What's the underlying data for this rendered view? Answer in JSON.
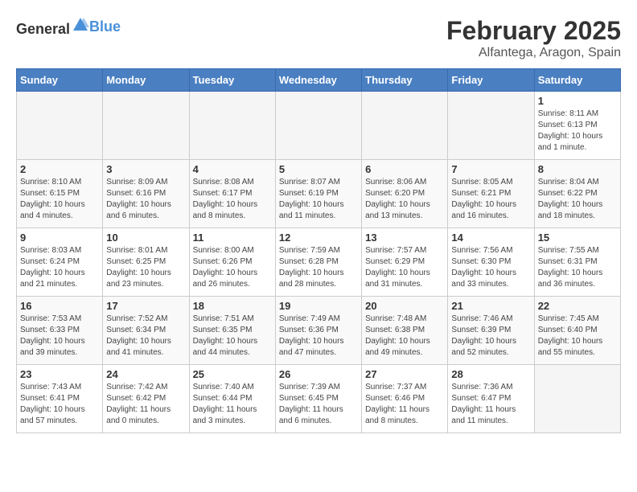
{
  "logo": {
    "general": "General",
    "blue": "Blue"
  },
  "title": "February 2025",
  "subtitle": "Alfantega, Aragon, Spain",
  "days_of_week": [
    "Sunday",
    "Monday",
    "Tuesday",
    "Wednesday",
    "Thursday",
    "Friday",
    "Saturday"
  ],
  "weeks": [
    [
      {
        "day": "",
        "info": ""
      },
      {
        "day": "",
        "info": ""
      },
      {
        "day": "",
        "info": ""
      },
      {
        "day": "",
        "info": ""
      },
      {
        "day": "",
        "info": ""
      },
      {
        "day": "",
        "info": ""
      },
      {
        "day": "1",
        "info": "Sunrise: 8:11 AM\nSunset: 6:13 PM\nDaylight: 10 hours and 1 minute."
      }
    ],
    [
      {
        "day": "2",
        "info": "Sunrise: 8:10 AM\nSunset: 6:15 PM\nDaylight: 10 hours and 4 minutes."
      },
      {
        "day": "3",
        "info": "Sunrise: 8:09 AM\nSunset: 6:16 PM\nDaylight: 10 hours and 6 minutes."
      },
      {
        "day": "4",
        "info": "Sunrise: 8:08 AM\nSunset: 6:17 PM\nDaylight: 10 hours and 8 minutes."
      },
      {
        "day": "5",
        "info": "Sunrise: 8:07 AM\nSunset: 6:19 PM\nDaylight: 10 hours and 11 minutes."
      },
      {
        "day": "6",
        "info": "Sunrise: 8:06 AM\nSunset: 6:20 PM\nDaylight: 10 hours and 13 minutes."
      },
      {
        "day": "7",
        "info": "Sunrise: 8:05 AM\nSunset: 6:21 PM\nDaylight: 10 hours and 16 minutes."
      },
      {
        "day": "8",
        "info": "Sunrise: 8:04 AM\nSunset: 6:22 PM\nDaylight: 10 hours and 18 minutes."
      }
    ],
    [
      {
        "day": "9",
        "info": "Sunrise: 8:03 AM\nSunset: 6:24 PM\nDaylight: 10 hours and 21 minutes."
      },
      {
        "day": "10",
        "info": "Sunrise: 8:01 AM\nSunset: 6:25 PM\nDaylight: 10 hours and 23 minutes."
      },
      {
        "day": "11",
        "info": "Sunrise: 8:00 AM\nSunset: 6:26 PM\nDaylight: 10 hours and 26 minutes."
      },
      {
        "day": "12",
        "info": "Sunrise: 7:59 AM\nSunset: 6:28 PM\nDaylight: 10 hours and 28 minutes."
      },
      {
        "day": "13",
        "info": "Sunrise: 7:57 AM\nSunset: 6:29 PM\nDaylight: 10 hours and 31 minutes."
      },
      {
        "day": "14",
        "info": "Sunrise: 7:56 AM\nSunset: 6:30 PM\nDaylight: 10 hours and 33 minutes."
      },
      {
        "day": "15",
        "info": "Sunrise: 7:55 AM\nSunset: 6:31 PM\nDaylight: 10 hours and 36 minutes."
      }
    ],
    [
      {
        "day": "16",
        "info": "Sunrise: 7:53 AM\nSunset: 6:33 PM\nDaylight: 10 hours and 39 minutes."
      },
      {
        "day": "17",
        "info": "Sunrise: 7:52 AM\nSunset: 6:34 PM\nDaylight: 10 hours and 41 minutes."
      },
      {
        "day": "18",
        "info": "Sunrise: 7:51 AM\nSunset: 6:35 PM\nDaylight: 10 hours and 44 minutes."
      },
      {
        "day": "19",
        "info": "Sunrise: 7:49 AM\nSunset: 6:36 PM\nDaylight: 10 hours and 47 minutes."
      },
      {
        "day": "20",
        "info": "Sunrise: 7:48 AM\nSunset: 6:38 PM\nDaylight: 10 hours and 49 minutes."
      },
      {
        "day": "21",
        "info": "Sunrise: 7:46 AM\nSunset: 6:39 PM\nDaylight: 10 hours and 52 minutes."
      },
      {
        "day": "22",
        "info": "Sunrise: 7:45 AM\nSunset: 6:40 PM\nDaylight: 10 hours and 55 minutes."
      }
    ],
    [
      {
        "day": "23",
        "info": "Sunrise: 7:43 AM\nSunset: 6:41 PM\nDaylight: 10 hours and 57 minutes."
      },
      {
        "day": "24",
        "info": "Sunrise: 7:42 AM\nSunset: 6:42 PM\nDaylight: 11 hours and 0 minutes."
      },
      {
        "day": "25",
        "info": "Sunrise: 7:40 AM\nSunset: 6:44 PM\nDaylight: 11 hours and 3 minutes."
      },
      {
        "day": "26",
        "info": "Sunrise: 7:39 AM\nSunset: 6:45 PM\nDaylight: 11 hours and 6 minutes."
      },
      {
        "day": "27",
        "info": "Sunrise: 7:37 AM\nSunset: 6:46 PM\nDaylight: 11 hours and 8 minutes."
      },
      {
        "day": "28",
        "info": "Sunrise: 7:36 AM\nSunset: 6:47 PM\nDaylight: 11 hours and 11 minutes."
      },
      {
        "day": "",
        "info": ""
      }
    ]
  ]
}
